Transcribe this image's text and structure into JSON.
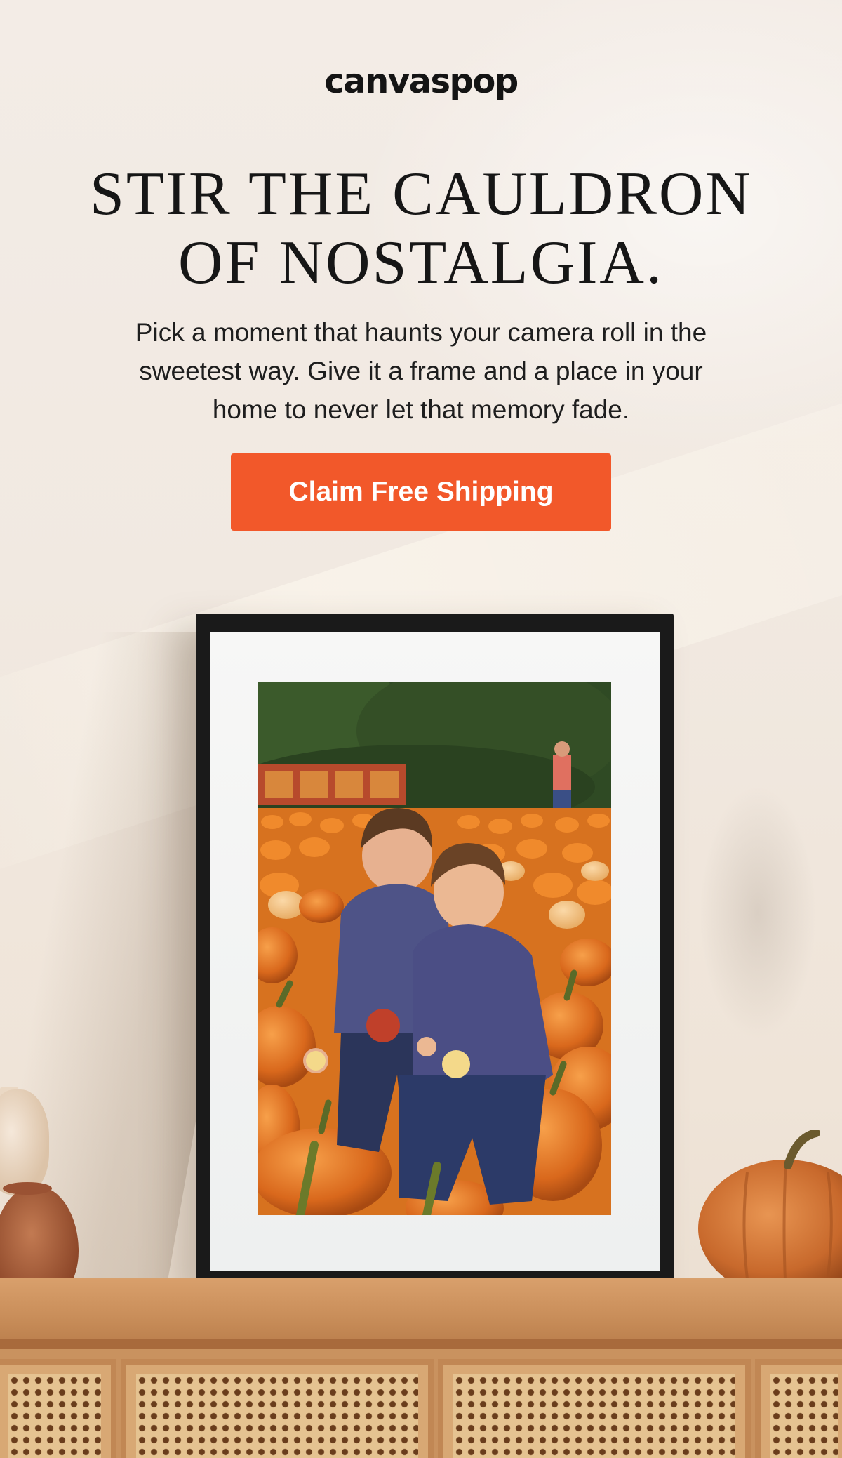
{
  "brand": {
    "logo_text": "canvaspop"
  },
  "headline": {
    "line1": "STIR THE CAULDRON",
    "line2": "OF NOSTALGIA."
  },
  "body": {
    "line1": "Pick a moment that haunts your camera roll in the",
    "line2": "sweetest way. Give it a frame and a place in your",
    "line3": "home to never let that memory fade."
  },
  "cta": {
    "label": "Claim Free Shipping"
  },
  "colors": {
    "accent": "#f2582a",
    "background": "#f3ece6",
    "text": "#161616",
    "frame": "#1a1a1a"
  },
  "image": {
    "subject": "framed-photo-two-boys-pumpkin-patch",
    "props": [
      "cream-vase",
      "clay-vase",
      "orange-pumpkin",
      "rattan-sideboard"
    ]
  }
}
